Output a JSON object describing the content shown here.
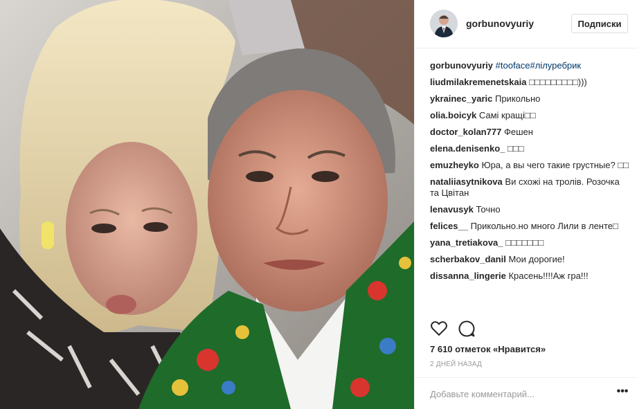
{
  "post": {
    "photo_description_icon": "selfie-photo",
    "author": "gorbunovyuriy",
    "follow_label": "Подписки",
    "caption": {
      "author": "gorbunovyuriy",
      "hashtags": "#tooface#лілуребрик"
    },
    "comments": [
      {
        "author": "liudmilakremenetskaia",
        "text": "□□□□□□□□□)))"
      },
      {
        "author": "ykrainec_yaric",
        "text": "Прикольно"
      },
      {
        "author": "olia.boicyk",
        "text": "Самі кращі□□"
      },
      {
        "author": "doctor_kolan777",
        "text": "Фешен"
      },
      {
        "author": "elena.denisenko_",
        "text": "□□□"
      },
      {
        "author": "emuzheyko",
        "text": "Юра, а вы чего такие грустные? □□"
      },
      {
        "author": "nataliiasytnikova",
        "text": "Ви схожі на тролів. Розочка та Цвітан"
      },
      {
        "author": "lenavusyk",
        "text": "Точно"
      },
      {
        "author": "felices__",
        "text": "Прикольно.но много Лили в ленте□"
      },
      {
        "author": "yana_tretiakova_",
        "text": "□□□□□□□"
      },
      {
        "author": "scherbakov_danil",
        "text": "Мои дорогие!"
      },
      {
        "author": "dissanna_lingerie",
        "text": "Красень!!!!Аж гра!!!"
      }
    ],
    "actions": {
      "like_icon": "heart-icon",
      "comment_icon": "comment-icon"
    },
    "likes": "7 610 отметок «Нравится»",
    "timestamp": "2 ДНЕЙ НАЗАД",
    "add_comment_placeholder": "Добавьте комментарий...",
    "more_label": "•••"
  },
  "colors": {
    "text": "#262626",
    "hashtag": "#003569",
    "muted": "#999999",
    "border": "#efefef"
  }
}
